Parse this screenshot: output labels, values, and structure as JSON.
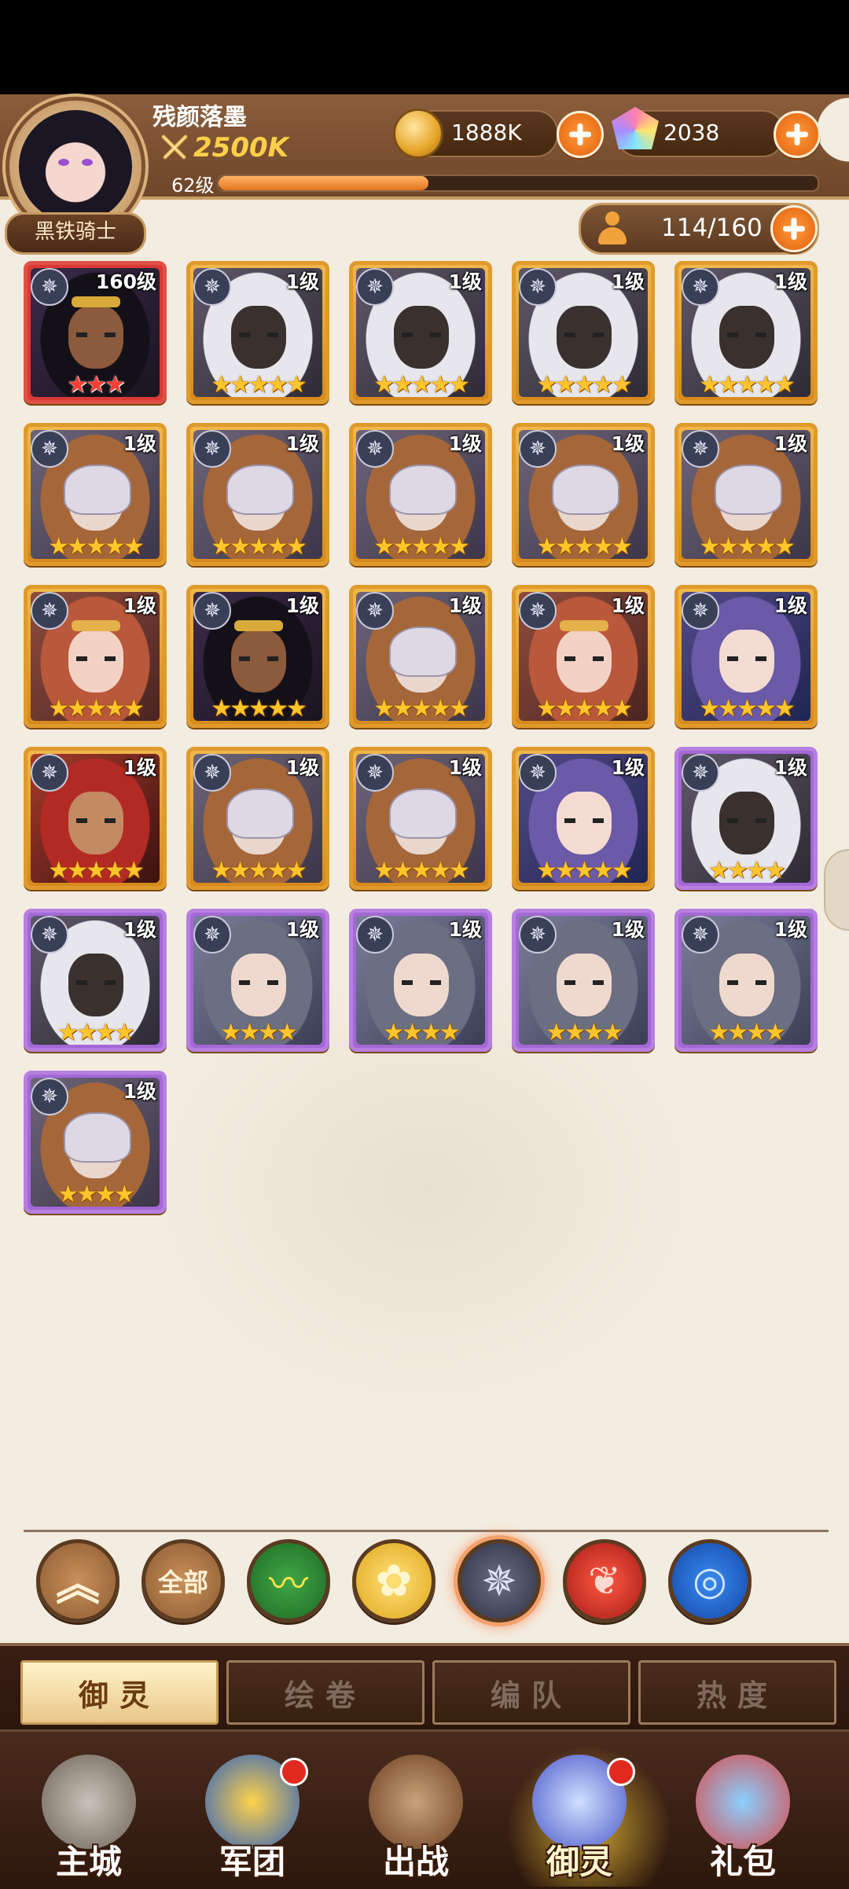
{
  "player": {
    "name": "残颜落墨",
    "power": "2500K",
    "level": "62级",
    "xp_fraction": 0.35,
    "rank": "黑铁骑士"
  },
  "currencies": {
    "gold": "1888K",
    "gems": "2038"
  },
  "roster": {
    "count": "114/160"
  },
  "heroes": [
    {
      "level": "160级",
      "stars": 3,
      "rarity": "red",
      "look": "dark-queen"
    },
    {
      "level": "1级",
      "stars": 5,
      "rarity": "gold",
      "look": "silver-hair"
    },
    {
      "level": "1级",
      "stars": 5,
      "rarity": "gold",
      "look": "silver-hair"
    },
    {
      "level": "1级",
      "stars": 5,
      "rarity": "gold",
      "look": "silver-hair"
    },
    {
      "level": "1级",
      "stars": 5,
      "rarity": "gold",
      "look": "silver-hair"
    },
    {
      "level": "1级",
      "stars": 5,
      "rarity": "gold",
      "look": "masked"
    },
    {
      "level": "1级",
      "stars": 5,
      "rarity": "gold",
      "look": "masked"
    },
    {
      "level": "1级",
      "stars": 5,
      "rarity": "gold",
      "look": "masked"
    },
    {
      "level": "1级",
      "stars": 5,
      "rarity": "gold",
      "look": "masked"
    },
    {
      "level": "1级",
      "stars": 5,
      "rarity": "gold",
      "look": "masked"
    },
    {
      "level": "1级",
      "stars": 5,
      "rarity": "gold",
      "look": "red-hair"
    },
    {
      "level": "1级",
      "stars": 5,
      "rarity": "gold",
      "look": "dark-queen"
    },
    {
      "level": "1级",
      "stars": 5,
      "rarity": "gold",
      "look": "masked"
    },
    {
      "level": "1级",
      "stars": 5,
      "rarity": "gold",
      "look": "red-hair"
    },
    {
      "level": "1级",
      "stars": 5,
      "rarity": "gold",
      "look": "hooded"
    },
    {
      "level": "1级",
      "stars": 5,
      "rarity": "gold",
      "look": "warrior"
    },
    {
      "level": "1级",
      "stars": 5,
      "rarity": "gold",
      "look": "masked"
    },
    {
      "level": "1级",
      "stars": 5,
      "rarity": "gold",
      "look": "masked"
    },
    {
      "level": "1级",
      "stars": 5,
      "rarity": "gold",
      "look": "hooded"
    },
    {
      "level": "1级",
      "stars": 4,
      "rarity": "purple",
      "look": "silver-hair"
    },
    {
      "level": "1级",
      "stars": 4,
      "rarity": "purple",
      "look": "silver-hair"
    },
    {
      "level": "1级",
      "stars": 4,
      "rarity": "purple",
      "look": "grey-hair"
    },
    {
      "level": "1级",
      "stars": 4,
      "rarity": "purple",
      "look": "grey-hair"
    },
    {
      "level": "1级",
      "stars": 4,
      "rarity": "purple",
      "look": "grey-hair"
    },
    {
      "level": "1级",
      "stars": 4,
      "rarity": "purple",
      "look": "grey-hair"
    },
    {
      "level": "1级",
      "stars": 4,
      "rarity": "purple",
      "look": "masked"
    }
  ],
  "filters": [
    {
      "id": "collapse",
      "label": "︽",
      "icon": "double-chevron-up-icon"
    },
    {
      "id": "all",
      "label": "全部",
      "icon": "all-filter-icon"
    },
    {
      "id": "wind",
      "label": "〰",
      "icon": "wind-element-icon"
    },
    {
      "id": "light",
      "label": "✿",
      "icon": "light-element-icon"
    },
    {
      "id": "dark",
      "label": "✵",
      "icon": "dark-element-icon",
      "selected": true
    },
    {
      "id": "fire",
      "label": "❦",
      "icon": "fire-element-icon"
    },
    {
      "id": "water",
      "label": "◎",
      "icon": "water-element-icon"
    }
  ],
  "tabs": [
    {
      "label": "御灵",
      "active": true
    },
    {
      "label": "绘卷",
      "active": false
    },
    {
      "label": "编队",
      "active": false
    },
    {
      "label": "热度",
      "active": false
    }
  ],
  "nav": [
    {
      "label": "主城",
      "icon": "castle-icon",
      "badge": false
    },
    {
      "label": "军团",
      "icon": "legion-fist-icon",
      "badge": true
    },
    {
      "label": "出战",
      "icon": "battle-gate-icon",
      "badge": false
    },
    {
      "label": "御灵",
      "icon": "spirit-crystal-icon",
      "badge": true,
      "active": true
    },
    {
      "label": "礼包",
      "icon": "gift-shop-icon",
      "badge": false
    }
  ],
  "colors": {
    "accent_orange": "#e1610f",
    "gold_frame": "#e09a2c",
    "purple_frame": "#b77fe0",
    "red_frame": "#e05048",
    "star_gold": "#ffc52a"
  }
}
